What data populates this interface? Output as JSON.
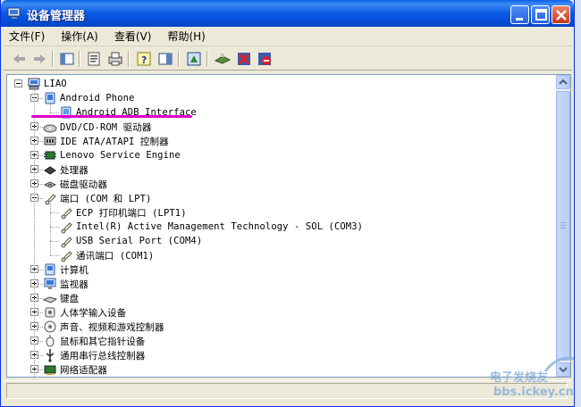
{
  "window": {
    "title": "设备管理器"
  },
  "menu": [
    "文件(F)",
    "操作(A)",
    "查看(V)",
    "帮助(H)"
  ],
  "toolbar": {
    "icons": [
      "back-icon",
      "forward-icon",
      "show-hide-tree-icon",
      "properties-icon",
      "print-icon",
      "help-icon",
      "view-icon",
      "update-driver-icon",
      "scan-hardware-icon",
      "uninstall-icon",
      "disable-icon"
    ]
  },
  "tree": {
    "root": "LIAO",
    "items": [
      {
        "label": "Android Phone",
        "level": 1,
        "expanded": true,
        "icon": "computer-device-icon"
      },
      {
        "label": "Android ADB Interface",
        "level": 2,
        "icon": "usb-device-icon"
      },
      {
        "label": "DVD/CD-ROM 驱动器",
        "level": 1,
        "expanded": false,
        "icon": "cdrom-icon"
      },
      {
        "label": "IDE ATA/ATAPI 控制器",
        "level": 1,
        "expanded": false,
        "icon": "ide-controller-icon"
      },
      {
        "label": "Lenovo Service Engine",
        "level": 1,
        "expanded": false,
        "icon": "chip-icon"
      },
      {
        "label": "处理器",
        "level": 1,
        "expanded": false,
        "icon": "processor-icon"
      },
      {
        "label": "磁盘驱动器",
        "level": 1,
        "expanded": false,
        "icon": "disk-drive-icon"
      },
      {
        "label": "端口 (COM 和 LPT)",
        "level": 1,
        "expanded": true,
        "icon": "port-icon"
      },
      {
        "label": "ECP 打印机端口 (LPT1)",
        "level": 2,
        "icon": "port-icon"
      },
      {
        "label": "Intel(R) Active Management Technology - SOL (COM3)",
        "level": 2,
        "icon": "port-icon"
      },
      {
        "label": "USB Serial Port (COM4)",
        "level": 2,
        "icon": "port-icon"
      },
      {
        "label": "通讯端口 (COM1)",
        "level": 2,
        "icon": "port-icon"
      },
      {
        "label": "计算机",
        "level": 1,
        "expanded": false,
        "icon": "computer-icon"
      },
      {
        "label": "监视器",
        "level": 1,
        "expanded": false,
        "icon": "monitor-icon"
      },
      {
        "label": "键盘",
        "level": 1,
        "expanded": false,
        "icon": "keyboard-icon"
      },
      {
        "label": "人体学输入设备",
        "level": 1,
        "expanded": false,
        "icon": "hid-icon"
      },
      {
        "label": "声音、视频和游戏控制器",
        "level": 1,
        "expanded": false,
        "icon": "sound-icon"
      },
      {
        "label": "鼠标和其它指针设备",
        "level": 1,
        "expanded": false,
        "icon": "mouse-icon"
      },
      {
        "label": "通用串行总线控制器",
        "level": 1,
        "expanded": false,
        "icon": "usb-icon"
      },
      {
        "label": "网络适配器",
        "level": 1,
        "expanded": false,
        "icon": "network-adapter-icon"
      }
    ]
  },
  "watermark": {
    "line1": "电子发烧友",
    "line2": "bbs.ickey.cn"
  },
  "colors": {
    "titlebar": "#0650db",
    "annotation": "#e000d0",
    "selection_border": "#7f9db9"
  }
}
